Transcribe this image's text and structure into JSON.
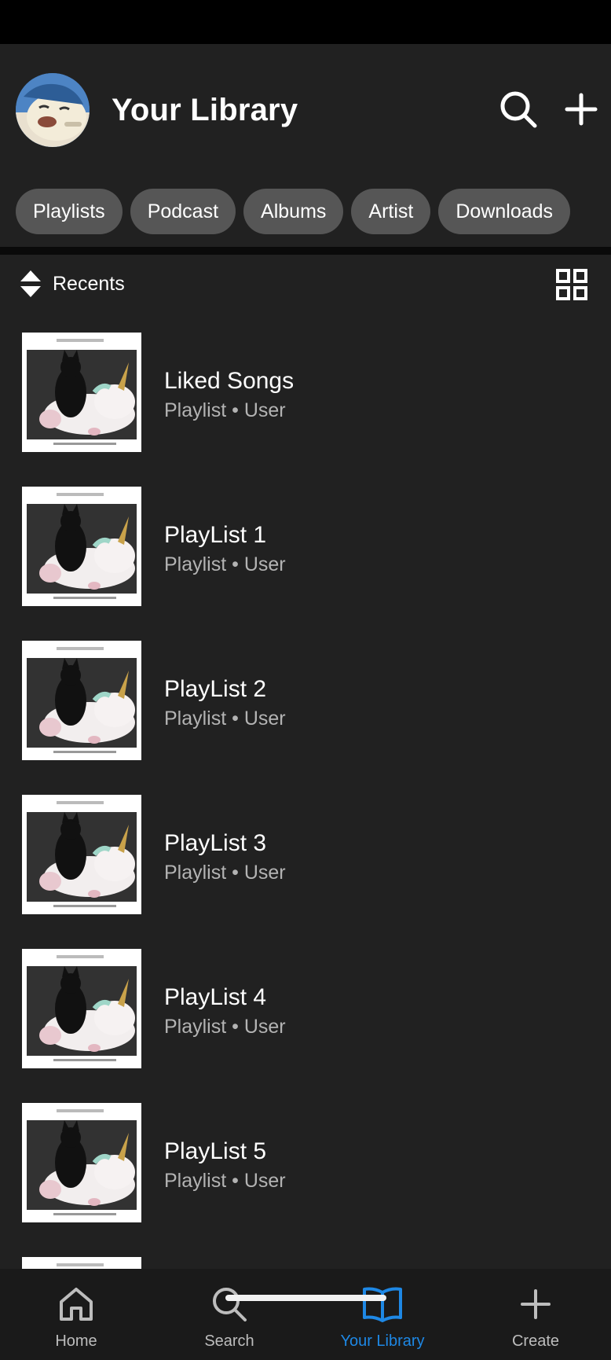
{
  "header": {
    "title": "Your Library",
    "avatar_icon": "avatar-cartoon-icon",
    "search_icon": "search-icon",
    "add_icon": "plus-icon"
  },
  "filters": [
    {
      "label": "Playlists"
    },
    {
      "label": "Podcast"
    },
    {
      "label": "Albums"
    },
    {
      "label": "Artist"
    },
    {
      "label": "Downloads"
    }
  ],
  "sort": {
    "label": "Recents",
    "sort_icon": "sort-updown-icon",
    "view_icon": "grid-view-icon"
  },
  "items": [
    {
      "title": "Liked Songs",
      "subtitle": "Playlist • User"
    },
    {
      "title": "PlayList 1",
      "subtitle": "Playlist • User"
    },
    {
      "title": "PlayList 2",
      "subtitle": "Playlist • User"
    },
    {
      "title": "PlayList 3",
      "subtitle": "Playlist • User"
    },
    {
      "title": "PlayList 4",
      "subtitle": "Playlist • User"
    },
    {
      "title": "PlayList 5",
      "subtitle": "Playlist • User"
    },
    {
      "title": "",
      "subtitle": ""
    }
  ],
  "nav": [
    {
      "label": "Home",
      "icon": "home-icon",
      "active": false
    },
    {
      "label": "Search",
      "icon": "search-icon",
      "active": false
    },
    {
      "label": "Your Library",
      "icon": "library-book-icon",
      "active": true
    },
    {
      "label": "Create",
      "icon": "plus-icon",
      "active": false
    }
  ],
  "colors": {
    "background": "#212121",
    "chip": "#565656",
    "accent": "#1e88e5",
    "subtitle": "#b3b3b3"
  }
}
